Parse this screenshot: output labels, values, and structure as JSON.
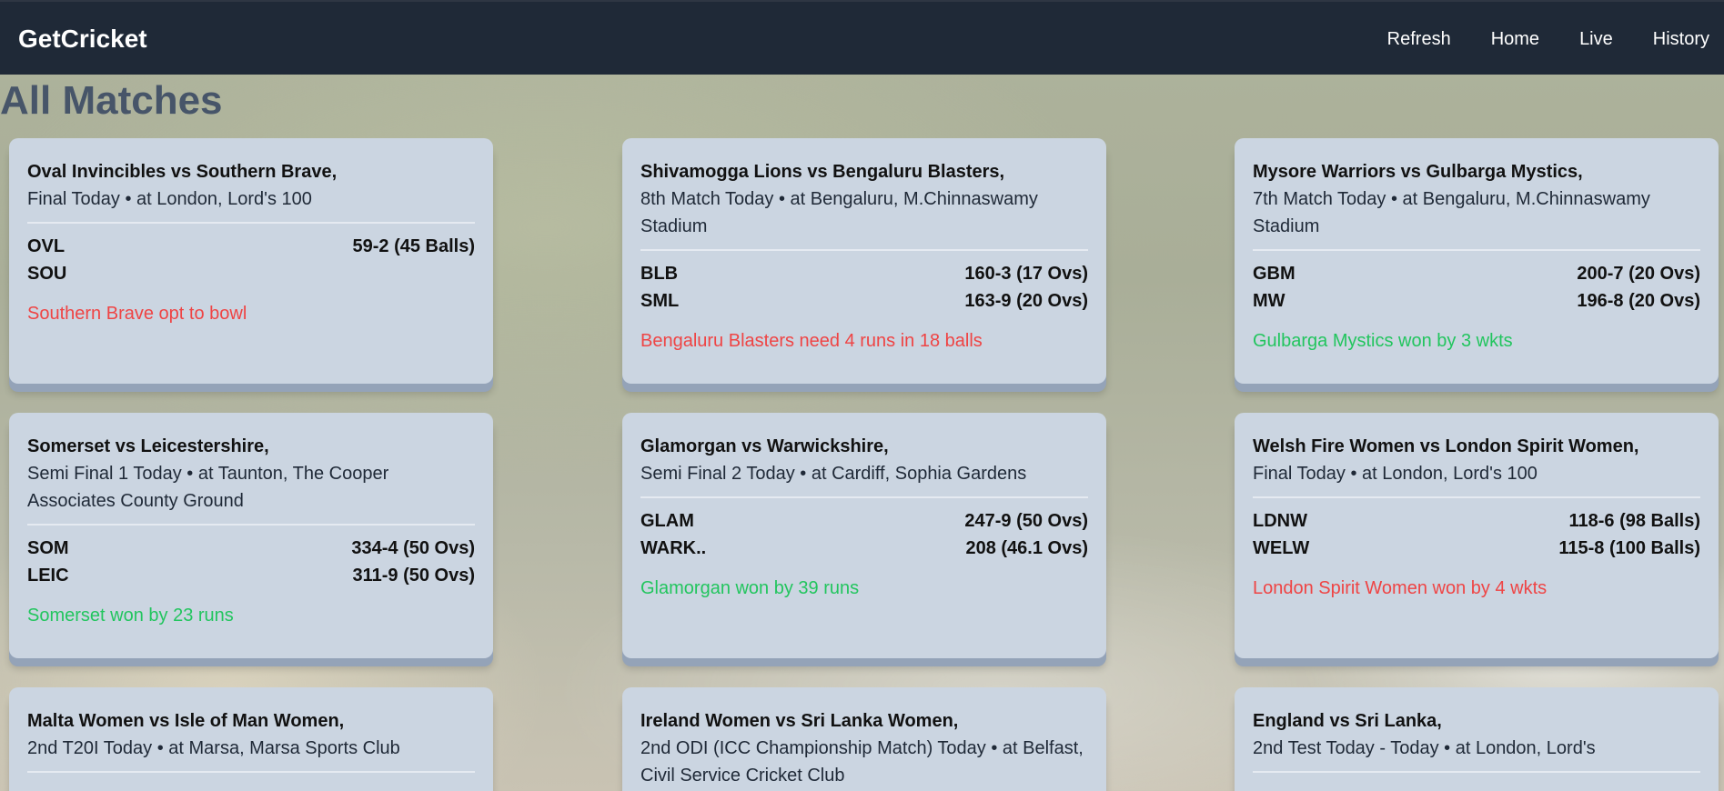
{
  "brand": "GetCricket",
  "nav": [
    "Refresh",
    "Home",
    "Live",
    "History"
  ],
  "page_title": "All Matches",
  "colors": {
    "navbar": "#1f2937",
    "card": "#cbd5e1",
    "status_live": "#ef4444",
    "status_result": "#22c55e",
    "title": "#475569"
  },
  "matches": [
    {
      "title": "Oval Invincibles vs Southern Brave,",
      "subtitle": "Final Today • at London, Lord's 100",
      "teams": [
        {
          "name": "OVL",
          "score": "59-2 (45 Balls)"
        },
        {
          "name": "SOU",
          "score": ""
        }
      ],
      "status": "Southern Brave opt to bowl",
      "status_color": "red"
    },
    {
      "title": "Shivamogga Lions vs Bengaluru Blasters,",
      "subtitle": "8th Match Today • at Bengaluru, M.Chinnaswamy Stadium",
      "teams": [
        {
          "name": "BLB",
          "score": "160-3 (17 Ovs)"
        },
        {
          "name": "SML",
          "score": "163-9 (20 Ovs)"
        }
      ],
      "status": "Bengaluru Blasters need 4 runs in 18 balls",
      "status_color": "red"
    },
    {
      "title": "Mysore Warriors vs Gulbarga Mystics,",
      "subtitle": "7th Match Today • at Bengaluru, M.Chinnaswamy Stadium",
      "teams": [
        {
          "name": "GBM",
          "score": "200-7 (20 Ovs)"
        },
        {
          "name": "MW",
          "score": "196-8 (20 Ovs)"
        }
      ],
      "status": "Gulbarga Mystics won by 3 wkts",
      "status_color": "green"
    },
    {
      "title": "Somerset vs Leicestershire,",
      "subtitle": "Semi Final 1 Today • at Taunton, The Cooper Associates County Ground",
      "teams": [
        {
          "name": "SOM",
          "score": "334-4 (50 Ovs)"
        },
        {
          "name": "LEIC",
          "score": "311-9 (50 Ovs)"
        }
      ],
      "status": "Somerset won by 23 runs",
      "status_color": "green"
    },
    {
      "title": "Glamorgan vs Warwickshire,",
      "subtitle": "Semi Final 2 Today • at Cardiff, Sophia Gardens",
      "teams": [
        {
          "name": "GLAM",
          "score": "247-9 (50 Ovs)"
        },
        {
          "name": "WARK..",
          "score": "208 (46.1 Ovs)"
        }
      ],
      "status": "Glamorgan won by 39 runs",
      "status_color": "green"
    },
    {
      "title": "Welsh Fire Women vs London Spirit Women,",
      "subtitle": "Final Today • at London, Lord's 100",
      "teams": [
        {
          "name": "LDNW",
          "score": "118-6 (98 Balls)"
        },
        {
          "name": "WELW",
          "score": "115-8 (100 Balls)"
        }
      ],
      "status": "London Spirit Women won by 4 wkts",
      "status_color": "red"
    },
    {
      "title": "Malta Women vs Isle of Man Women,",
      "subtitle": "2nd T20I Today • at Marsa, Marsa Sports Club",
      "teams": [],
      "status": "",
      "status_color": "red"
    },
    {
      "title": "Ireland Women vs Sri Lanka Women,",
      "subtitle": "2nd ODI (ICC Championship Match) Today • at Belfast, Civil Service Cricket Club",
      "teams": [],
      "status": "",
      "status_color": "red"
    },
    {
      "title": "England vs Sri Lanka,",
      "subtitle": "2nd Test Today - Today • at London, Lord's",
      "teams": [],
      "status": "",
      "status_color": "red"
    }
  ]
}
